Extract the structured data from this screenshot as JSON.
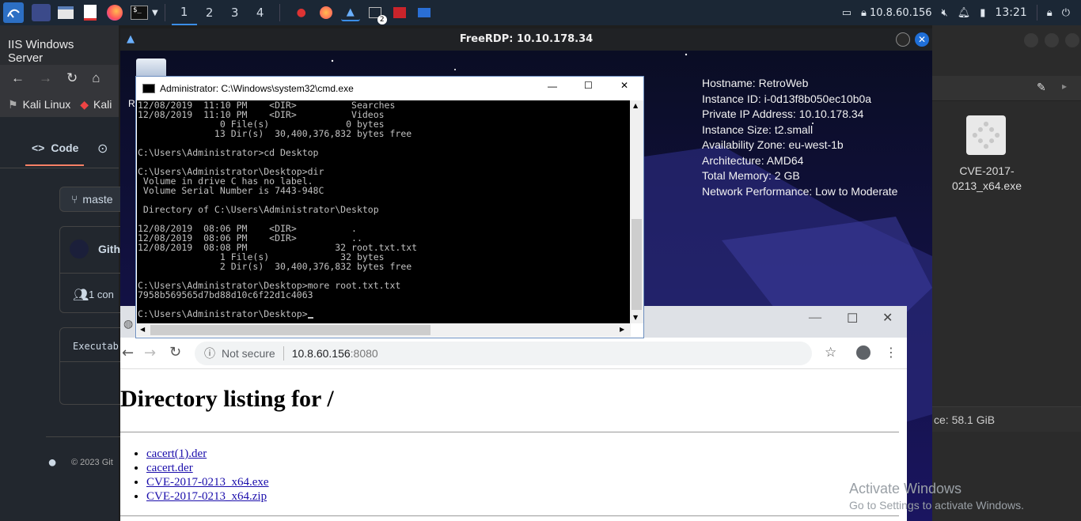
{
  "taskbar": {
    "workspaces": [
      "1",
      "2",
      "3",
      "4"
    ],
    "badge": "2",
    "ip": "10.8.60.156",
    "time": "13:21"
  },
  "left_browser": {
    "title": "IIS Windows Server",
    "bookmark1": "Kali Linux",
    "bookmark2": "Kali",
    "tab_code": "Code",
    "branch": "maste",
    "repo": "Gith",
    "contributors": "1 con",
    "executable": "Executab",
    "footer": "© 2023 Git"
  },
  "rdp": {
    "title": "FreeRDP: 10.10.178.34",
    "recycle_label": "R"
  },
  "sysinfo": [
    "Hostname: RetroWeb",
    "Instance ID: i-0d13f8b050ec10b0a",
    "Private IP Address: 10.10.178.34",
    "Instance Size: t2.small",
    "Availability Zone: eu-west-1b",
    "Architecture: AMD64",
    "Total Memory: 2 GB",
    "Network Performance: Low to Moderate"
  ],
  "cmd": {
    "title": "Administrator: C:\\Windows\\system32\\cmd.exe",
    "lines": [
      "12/08/2019  11:10 PM    <DIR>          Searches",
      "12/08/2019  11:10 PM    <DIR>          Videos",
      "               0 File(s)              0 bytes",
      "              13 Dir(s)  30,400,376,832 bytes free",
      "",
      "C:\\Users\\Administrator>cd Desktop",
      "",
      "C:\\Users\\Administrator\\Desktop>dir",
      " Volume in drive C has no label.",
      " Volume Serial Number is 7443-948C",
      "",
      " Directory of C:\\Users\\Administrator\\Desktop",
      "",
      "12/08/2019  08:06 PM    <DIR>          .",
      "12/08/2019  08:06 PM    <DIR>          ..",
      "12/08/2019  08:08 PM                32 root.txt.txt",
      "               1 File(s)             32 bytes",
      "               2 Dir(s)  30,400,376,832 bytes free",
      "",
      "C:\\Users\\Administrator\\Desktop>more root.txt.txt",
      "7958b569565d7bd88d10c6f22d1c4063",
      "",
      "C:\\Users\\Administrator\\Desktop>"
    ]
  },
  "chrome": {
    "not_secure": "Not secure",
    "url_host": "10.8.60.156",
    "url_port": ":8080",
    "heading": "Directory listing for /",
    "files": [
      "cacert(1).der",
      "cacert.der",
      "CVE-2017-0213_x64.exe",
      "CVE-2017-0213_x64.zip"
    ]
  },
  "right_panel": {
    "file_name": "CVE-2017-0213_x64.exe",
    "space": "ce: 58.1 GiB"
  },
  "watermark": {
    "line1": "Activate Windows",
    "line2": "Go to Settings to activate Windows."
  }
}
